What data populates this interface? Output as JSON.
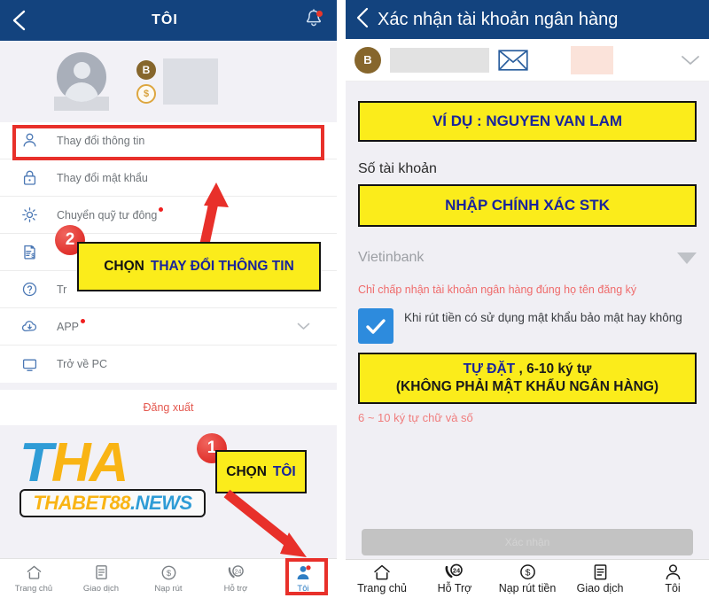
{
  "left_panel": {
    "header": {
      "title": "TÔI",
      "back_icon": "chevron-left-icon",
      "bell_icon": "bell-icon"
    },
    "profile": {
      "avatar_icon": "avatar-placeholder-icon",
      "coin_b_label": "B",
      "coin_dollar_label": "$"
    },
    "menu": [
      {
        "label": "Thay đổi thông tin",
        "icon": "user-icon",
        "dot": false,
        "chevron": false
      },
      {
        "label": "Thay đổi mật khẩu",
        "icon": "lock-icon",
        "dot": false,
        "chevron": false
      },
      {
        "label": "Chuyển quỹ tư đông",
        "icon": "gear-icon",
        "dot": true,
        "chevron": false
      },
      {
        "label": "",
        "icon": "document-money-icon",
        "dot": false,
        "chevron": false
      },
      {
        "label": "Tr",
        "icon": "question-circle-icon",
        "dot": false,
        "chevron": false
      },
      {
        "label": "APP",
        "icon": "cloud-download-icon",
        "dot": true,
        "chevron": true
      },
      {
        "label": "Trở về PC",
        "icon": "monitor-icon",
        "dot": false,
        "chevron": false
      }
    ],
    "logout_label": "Đăng xuất",
    "brand": {
      "line1_t": "T",
      "line1_ha": "HA",
      "sub_orange": "THABET88",
      "sub_blue": ".NEWS"
    },
    "bottom_nav": [
      {
        "label": "Trang chủ",
        "icon": "home-icon",
        "active": false
      },
      {
        "label": "Giao dịch",
        "icon": "document-icon",
        "active": false
      },
      {
        "label": "Nạp rút",
        "icon": "dollar-circle-icon",
        "active": false
      },
      {
        "label": "Hỗ trợ",
        "icon": "support-24-icon",
        "active": false
      },
      {
        "label": "Tôi",
        "icon": "user-icon",
        "active": true
      }
    ]
  },
  "right_panel": {
    "header": {
      "title": "Xác nhận tài khoản ngân hàng",
      "back_icon": "chevron-left-icon"
    },
    "account_row": {
      "coin_label": "B",
      "mail_icon": "envelope-icon",
      "chevron_icon": "chevron-down-icon"
    },
    "example_box": "VÍ DỤ : NGUYEN VAN LAM",
    "account_number_label": "Số tài khoản",
    "account_number_box": "NHẬP CHÍNH XÁC STK",
    "bank_select_value": "Vietinbank",
    "red_note": "Chỉ chấp nhận tài khoản ngân hàng đúng họ tên đăng ký",
    "checkbox_label": "Khi rút tiền có sử dụng mật khẩu bảo mật hay không",
    "password_box": {
      "line1_bold": "TỰ ĐẶT",
      "line1_rest": " , 6-10 ký tự",
      "line2": "(KHÔNG PHẢI MẬT KHẨU NGÂN HÀNG)"
    },
    "pink_note": "6 ~ 10 ký tự chữ và số",
    "submit_label": "Xác nhận",
    "bottom_nav": [
      {
        "label": "Trang chủ",
        "icon": "home-icon"
      },
      {
        "label": "Hỗ Trợ",
        "icon": "support-24-icon"
      },
      {
        "label": "Nạp rút tiền",
        "icon": "dollar-circle-icon"
      },
      {
        "label": "Giao dịch",
        "icon": "document-icon"
      },
      {
        "label": "Tôi",
        "icon": "user-icon"
      }
    ]
  },
  "annotations": {
    "step1_number": "1",
    "step1_black": "CHỌN",
    "step1_blue": "TÔI",
    "step2_number": "2",
    "step2_black": "CHỌN",
    "step2_blue": "THAY ĐỔI THÔNG TIN"
  },
  "colors": {
    "header_blue": "#13437e",
    "accent_yellow": "#fbec1b",
    "annotation_red": "#e8302a",
    "text_blue": "#19249c",
    "brand_orange": "#f9b414",
    "brand_blue": "#2f9cd6"
  }
}
